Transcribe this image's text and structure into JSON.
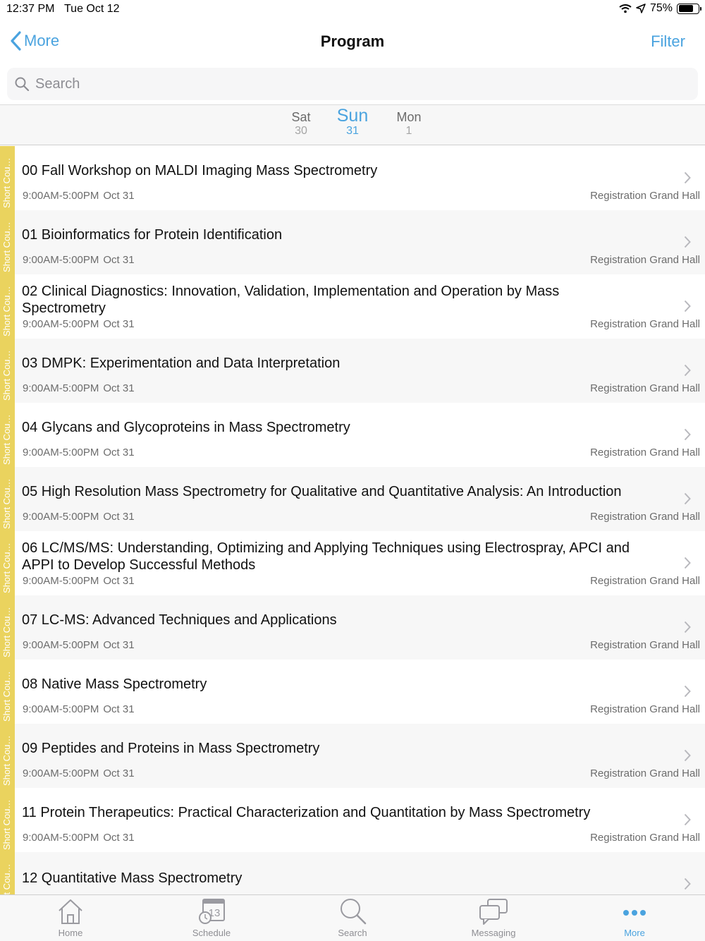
{
  "status": {
    "time": "12:37 PM",
    "date": "Tue Oct 12",
    "battery": "75%",
    "battery_level": 0.75
  },
  "nav": {
    "back_label": "More",
    "title": "Program",
    "filter_label": "Filter"
  },
  "search": {
    "placeholder": "Search"
  },
  "days": [
    {
      "name": "Sat",
      "num": "30"
    },
    {
      "name": "Sun",
      "num": "31",
      "active": true
    },
    {
      "name": "Mon",
      "num": "1"
    }
  ],
  "track_label": "Short Cou…",
  "sessions": [
    {
      "title": "00 Fall Workshop on MALDI Imaging Mass Spectrometry",
      "time": "9:00AM-5:00PM",
      "date": "Oct 31",
      "location": "Registration Grand Hall"
    },
    {
      "title": "01 Bioinformatics for Protein Identification",
      "time": "9:00AM-5:00PM",
      "date": "Oct 31",
      "location": "Registration Grand Hall"
    },
    {
      "title": "02 Clinical Diagnostics: Innovation, Validation, Implementation and Operation by Mass Spectrometry",
      "time": "9:00AM-5:00PM",
      "date": "Oct 31",
      "location": "Registration Grand Hall"
    },
    {
      "title": "03 DMPK: Experimentation and Data Interpretation",
      "time": "9:00AM-5:00PM",
      "date": "Oct 31",
      "location": "Registration Grand Hall"
    },
    {
      "title": "04 Glycans and Glycoproteins in Mass Spectrometry",
      "time": "9:00AM-5:00PM",
      "date": "Oct 31",
      "location": "Registration Grand Hall"
    },
    {
      "title": "05 High Resolution Mass Spectrometry for Qualitative and Quantitative Analysis: An Introduction",
      "time": "9:00AM-5:00PM",
      "date": "Oct 31",
      "location": "Registration Grand Hall"
    },
    {
      "title": "06 LC/MS/MS: Understanding, Optimizing and Applying Techniques using Electrospray, APCI and APPI to Develop Successful Methods",
      "time": "9:00AM-5:00PM",
      "date": "Oct 31",
      "location": "Registration Grand Hall"
    },
    {
      "title": "07 LC-MS: Advanced Techniques and Applications",
      "time": "9:00AM-5:00PM",
      "date": "Oct 31",
      "location": "Registration Grand Hall"
    },
    {
      "title": "08 Native Mass Spectrometry",
      "time": "9:00AM-5:00PM",
      "date": "Oct 31",
      "location": "Registration Grand Hall"
    },
    {
      "title": "09 Peptides and Proteins in Mass Spectrometry",
      "time": "9:00AM-5:00PM",
      "date": "Oct 31",
      "location": "Registration Grand Hall"
    },
    {
      "title": "11 Protein Therapeutics: Practical Characterization and Quantitation by Mass Spectrometry",
      "time": "9:00AM-5:00PM",
      "date": "Oct 31",
      "location": "Registration Grand Hall"
    },
    {
      "title": "12 Quantitative Mass Spectrometry",
      "time": "",
      "date": "",
      "location": ""
    }
  ],
  "tabs": [
    {
      "label": "Home",
      "icon": "house-icon"
    },
    {
      "label": "Schedule",
      "icon": "calendar-clock-icon",
      "badge": "13"
    },
    {
      "label": "Search",
      "icon": "magnifier-icon"
    },
    {
      "label": "Messaging",
      "icon": "chat-bubbles-icon"
    },
    {
      "label": "More",
      "icon": "ellipsis-icon",
      "active": true
    }
  ],
  "colors": {
    "accent": "#4aa3df",
    "track": "#ead35e",
    "row_alt": "#f7f7f7"
  }
}
